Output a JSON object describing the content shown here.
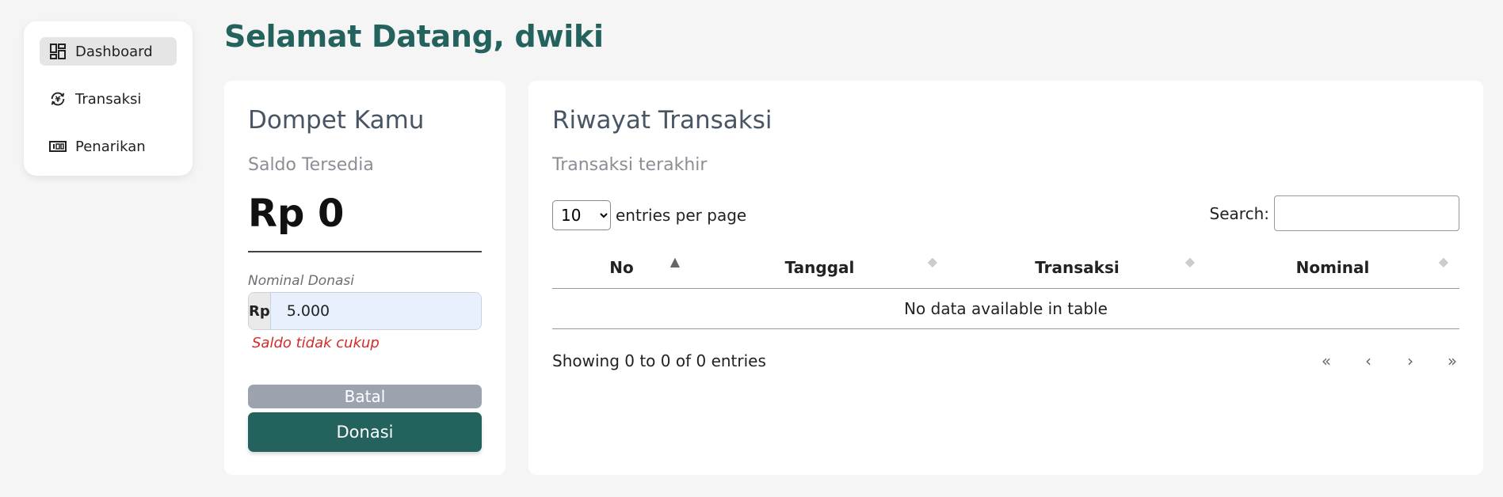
{
  "sidebar": {
    "items": [
      {
        "label": "Dashboard",
        "icon": "dashboard-icon",
        "active": true
      },
      {
        "label": "Transaksi",
        "icon": "currency-exchange-icon",
        "active": false
      },
      {
        "label": "Penarikan",
        "icon": "cash-icon",
        "active": false
      }
    ]
  },
  "header": {
    "greeting": "Selamat Datang, dwiki"
  },
  "wallet": {
    "title": "Dompet Kamu",
    "subtitle": "Saldo Tersedia",
    "balance": "Rp 0",
    "field_label": "Nominal Donasi",
    "currency_prefix": "Rp",
    "amount_value": "5.000",
    "error": "Saldo tidak cukup",
    "cancel_label": "Batal",
    "donate_label": "Donasi"
  },
  "history": {
    "title": "Riwayat Transaksi",
    "subtitle": "Transaksi terakhir",
    "per_page_value": "10",
    "per_page_label": "entries per page",
    "search_label": "Search:",
    "columns": [
      "No",
      "Tanggal",
      "Transaksi",
      "Nominal"
    ],
    "empty_message": "No data available in table",
    "info": "Showing 0 to 0 of 0 entries",
    "pager": [
      "«",
      "‹",
      "›",
      "»"
    ]
  },
  "colors": {
    "brand": "#23625d",
    "error": "#d62828",
    "cancel": "#9ca3af"
  }
}
